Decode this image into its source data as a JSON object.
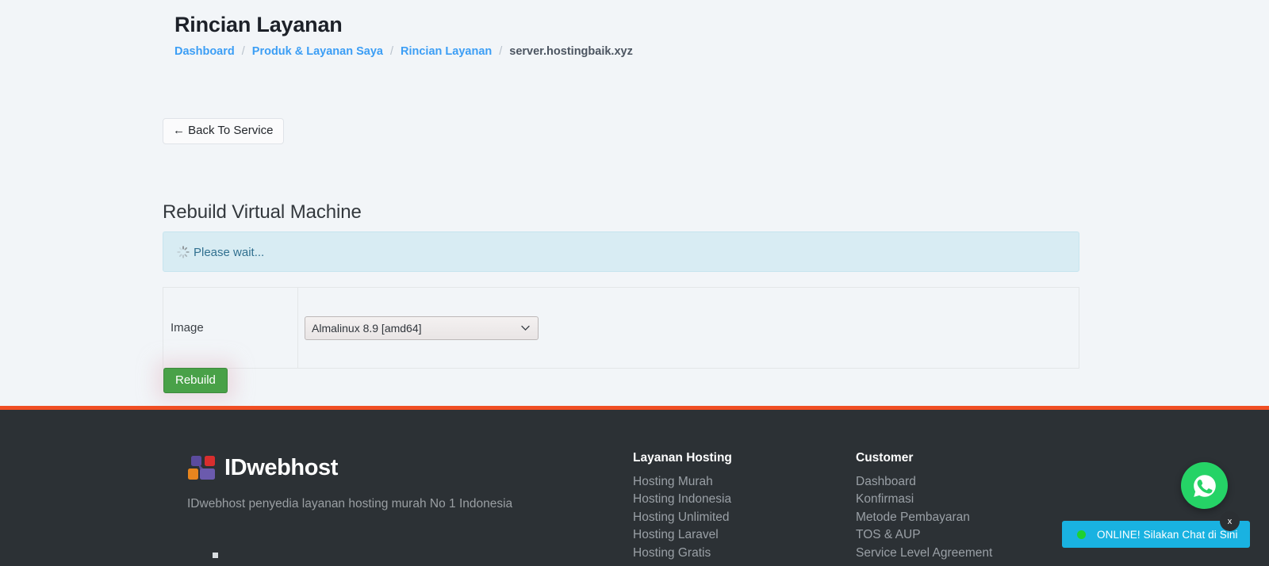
{
  "page": {
    "title": "Rincian Layanan",
    "breadcrumb": [
      {
        "label": "Dashboard",
        "link": true
      },
      {
        "label": "Produk & Layanan Saya",
        "link": true
      },
      {
        "label": "Rincian Layanan",
        "link": true
      },
      {
        "label": "server.hostingbaik.xyz",
        "link": false
      }
    ],
    "separator": "/",
    "back_button": "← Back To Service",
    "section_title": "Rebuild Virtual Machine"
  },
  "alert": {
    "icon": "spinner-icon",
    "text": "Please wait..."
  },
  "form": {
    "rows": [
      {
        "label": "Image",
        "field_type": "select",
        "value": "Almalinux 8.9 [amd64]",
        "options": [
          "Almalinux 8.9 [amd64]"
        ]
      }
    ],
    "submit_label": "Rebuild"
  },
  "colors": {
    "page_background": "#f2f5f8",
    "accent_red": "#f04e23",
    "footer_background": "#2c3135",
    "submit_green": "#49a148",
    "link_blue": "#3c9ef5",
    "alert_background": "#d8ecf3",
    "alert_text": "#31708f",
    "whatsapp_green": "#25d366",
    "chat_blue": "#19b2e1",
    "logo_purple": "#5b4b9e",
    "logo_red": "#d82e2e",
    "logo_orange": "#e8851e"
  },
  "footer": {
    "logo_text": "IDwebhost",
    "tagline": "IDwebhost penyedia layanan hosting murah No 1 Indonesia",
    "columns": [
      {
        "heading": "Layanan Hosting",
        "links": [
          "Hosting Murah",
          "Hosting Indonesia",
          "Hosting Unlimited",
          "Hosting Laravel",
          "Hosting Gratis"
        ]
      },
      {
        "heading": "Customer",
        "links": [
          "Dashboard",
          "Konfirmasi",
          "Metode Pembayaran",
          "TOS & AUP",
          "Service Level Agreement"
        ]
      }
    ]
  },
  "chat": {
    "status_label": "ONLINE! Silakan Chat di Sini",
    "close_label": "x",
    "whatsapp_icon": "whatsapp-icon",
    "status_dot_color": "#1fd12f"
  }
}
